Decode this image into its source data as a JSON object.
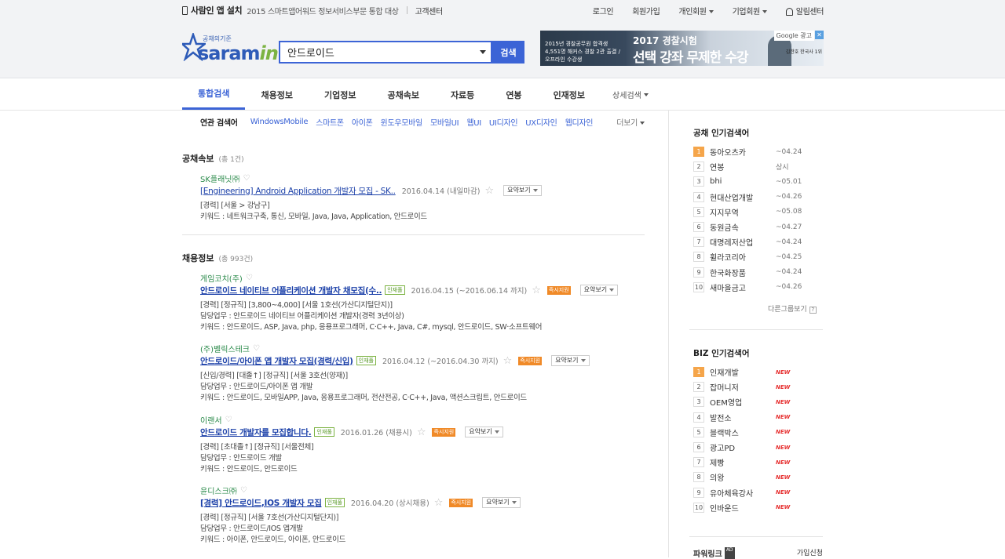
{
  "topbar": {
    "app_install": "사람인 앱 설치",
    "award": "2015 스마트앱어워드 정보서비스부문 통합 대상",
    "support": "고객센터",
    "login": "로그인",
    "signup": "회원가입",
    "personal": "개인회원",
    "company": "기업회원",
    "alert": "알림센터"
  },
  "logo": {
    "tagline": "공채의기준",
    "word_a": "saram",
    "word_b": "in"
  },
  "search": {
    "value": "안드로이드",
    "button": "검색"
  },
  "ad": {
    "line1": "2015년 경찰공무원 합격생 4,551명 해커스 경찰 2관 출결 / 오프라인 수강생",
    "line2": "2017 경찰시험",
    "line3": "선택 강좌 무제한 수강",
    "google": "Google 광고",
    "close": "✕",
    "tag": "김한호 한국사 1위"
  },
  "nav": {
    "tabs": [
      "통합검색",
      "채용정보",
      "기업정보",
      "공채속보",
      "자료등",
      "연봉",
      "인재정보"
    ],
    "detail": "상세검색"
  },
  "related": {
    "label": "연관 검색어",
    "keywords": [
      "WindowsMobile",
      "스마트폰",
      "아이폰",
      "윈도우모바일",
      "모바일UI",
      "웹UI",
      "UI디자인",
      "UX디자인",
      "웹디자인"
    ],
    "more": "더보기"
  },
  "section1": {
    "title": "공채속보",
    "count": "(총 1건)",
    "items": [
      {
        "company": "SK플래닛㈜",
        "title": "[Engineering] Android Application 개발자 모집 - SK..",
        "date": "2016.04.14 (내일마감)",
        "summary": "요약보기",
        "lines": [
          "[경력] [서울 > 강남구]",
          "키워드 : 네트워크구축, 통신, 모바일, Java, Java, Application, 안드로이드"
        ]
      }
    ]
  },
  "section2": {
    "title": "채용정보",
    "count": "(총 993건)",
    "items": [
      {
        "company": "게임코치(주)",
        "title": "안드로이드 네이티브 어플리케이션 개발자 채모집(수..",
        "badge": "인재풀",
        "date": "2016.04.15 (~2016.06.14 까지)",
        "quick": "즉시지원",
        "summary": "요약보기",
        "lines": [
          "[경력] [정규직] [3,800~4,000] [서울 1호선(가산디지털단지)]",
          "담당업무 : 안드로이드 네이티브 어플리케이션 개발자(경력 3년이상)",
          "키워드 : 안드로이드, ASP, Java, php, 응용프로그래머, C·C++, Java, C#, mysql, 안드로이드, SW·소프트웨어"
        ]
      },
      {
        "company": "(주)벨릭스테크",
        "title": "안드로이드/아이폰 앱 개발자 모집(경력/신입)",
        "badge": "인재풀",
        "date": "2016.04.12 (~2016.04.30 까지)",
        "quick": "즉시지원",
        "summary": "요약보기",
        "lines": [
          "[신입/경력] [대졸↑] [정규직] [서울 3호선(양재)]",
          "담당업무 : 안드로이드/아이폰 앱 개발",
          "키워드 : 안드로이드, 모바일APP, Java, 응용프로그래머, 전산전공, C·C++, Java, 액션스크립트, 안드로이드"
        ]
      },
      {
        "company": "이랜서",
        "title": "안드로이드 개발자를 모집합니다.",
        "badge": "인재풀",
        "date": "2016.01.26 (채용시)",
        "quick": "즉시지원",
        "summary": "요약보기",
        "lines": [
          "[경력] [초대졸↑] [정규직] [서울전체]",
          "담당업무 : 안드로이드 개발",
          "키워드 : 안드로이드, 안드로이드"
        ]
      },
      {
        "company": "윤디스크㈜",
        "title": "[경력] 안드로이드,IOS 개발자 모집",
        "badge": "인재풀",
        "date": "2016.04.20 (상시채용)",
        "quick": "즉시지원",
        "summary": "요약보기",
        "lines": [
          "[경력] [정규직] [서울 7호선(가산디지털단지)]",
          "담당업무 : 안드로이드/IOS 앱개발",
          "키워드 : 아이폰, 안드로이드, 아이폰, 안드로이드"
        ]
      }
    ]
  },
  "side_popular": {
    "title": "공채 인기검색어",
    "items": [
      {
        "n": "1",
        "name": "동아오츠카",
        "status": "~04.24"
      },
      {
        "n": "2",
        "name": "연봉",
        "status": "상시"
      },
      {
        "n": "3",
        "name": "bhi",
        "status": "~05.01"
      },
      {
        "n": "4",
        "name": "현대산업개발",
        "status": "~04.26"
      },
      {
        "n": "5",
        "name": "지지무역",
        "status": "~05.08"
      },
      {
        "n": "6",
        "name": "동원금속",
        "status": "~04.27"
      },
      {
        "n": "7",
        "name": "대명레저산업",
        "status": "~04.24"
      },
      {
        "n": "8",
        "name": "휠라코리아",
        "status": "~04.25"
      },
      {
        "n": "9",
        "name": "한국화장품",
        "status": "~04.24"
      },
      {
        "n": "10",
        "name": "새마을금고",
        "status": "~04.26"
      }
    ],
    "other": "다른그룹보기"
  },
  "side_biz": {
    "title": "BIZ 인기검색어",
    "new_label": "NEW",
    "items": [
      {
        "n": "1",
        "name": "인재개발"
      },
      {
        "n": "2",
        "name": "잡머니저"
      },
      {
        "n": "3",
        "name": "OEM영업"
      },
      {
        "n": "4",
        "name": "발전소"
      },
      {
        "n": "5",
        "name": "블랙박스"
      },
      {
        "n": "6",
        "name": "광고PD"
      },
      {
        "n": "7",
        "name": "제빵"
      },
      {
        "n": "8",
        "name": "의왕"
      },
      {
        "n": "9",
        "name": "유아체육강사"
      },
      {
        "n": "10",
        "name": "인바운드"
      }
    ]
  },
  "power": {
    "title": "파워링크",
    "ad": "AD",
    "apply": "가입신청"
  }
}
